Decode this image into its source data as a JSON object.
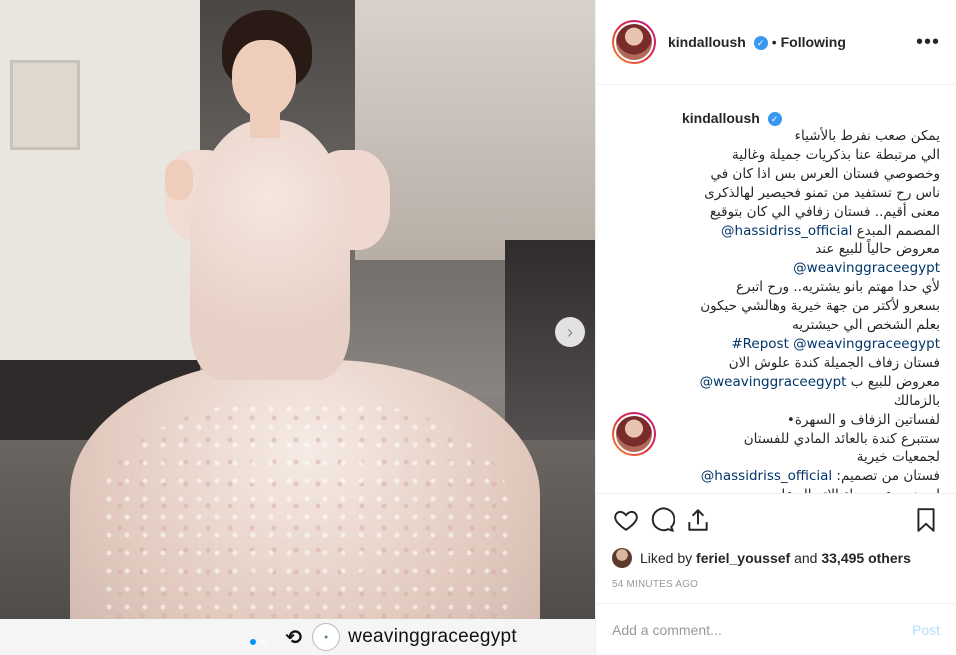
{
  "photo": {
    "repost_handle": "weavinggraceegypt",
    "repost_icon": "repost-icon",
    "dots": 2
  },
  "post": {
    "username": "kindalloush",
    "separator": "•",
    "follow_status": "Following",
    "more_icon": "•••"
  },
  "caption": {
    "username": "kindalloush",
    "lines": [
      {
        "text": "يمكن صعب نفرط بالأشياء"
      },
      {
        "text": "الي مرتبطة عنا بذكريات جميلة وغالية"
      },
      {
        "text": "وخصوصي فستان العرس بس اذا كان في"
      },
      {
        "text": "ناس رح تستفيد من تمنو فحيصير لهالذكرى"
      },
      {
        "text": "معنى أقيم.. فستان زفافي الي كان بتوقيع"
      },
      {
        "pre": "المصمم المبدع ",
        "link": "@hassidriss_official"
      },
      {
        "text": "معروض حالياً للبيع عند"
      },
      {
        "link": "@weavinggraceegypt"
      },
      {
        "text": "لأي حدا مهتم بانو يشتريه.. ورح اتبرع"
      },
      {
        "text": "بسعرو لأكتر من جهة خيرية وهالشي حيكون"
      },
      {
        "text": "بعلم الشخص الي حيشتريه"
      },
      {
        "link": "#Repost @weavinggraceegypt"
      },
      {
        "text": "فستان زفاف الجميلة كندة علوش الان"
      },
      {
        "pre": "معروض للبيع ب ",
        "link": "@weavinggraceegypt"
      },
      {
        "text": "بالزمالك"
      },
      {
        "text": "لفساتين الزفاف و السهرة•"
      },
      {
        "text": "ستتبرع كندة بالعائد المادي للفستان"
      },
      {
        "text": "لجمعيات خيرية"
      },
      {
        "pre": "فستان من تصميم: ",
        "link": "@hassidriss_official"
      },
      {
        "text": "لحجز موعد برجاء الاتصال على"
      }
    ]
  },
  "likes": {
    "prefix": "Liked by ",
    "user": "feriel_youssef",
    "middle": " and ",
    "count": "33,495 others"
  },
  "timestamp": "54 MINUTES AGO",
  "add_comment": {
    "placeholder": "Add a comment...",
    "post_label": "Post"
  },
  "colors": {
    "link": "#003569",
    "verified": "#3897f0",
    "post_disabled": "#b2dffc",
    "active_dot": "#0095f6"
  }
}
